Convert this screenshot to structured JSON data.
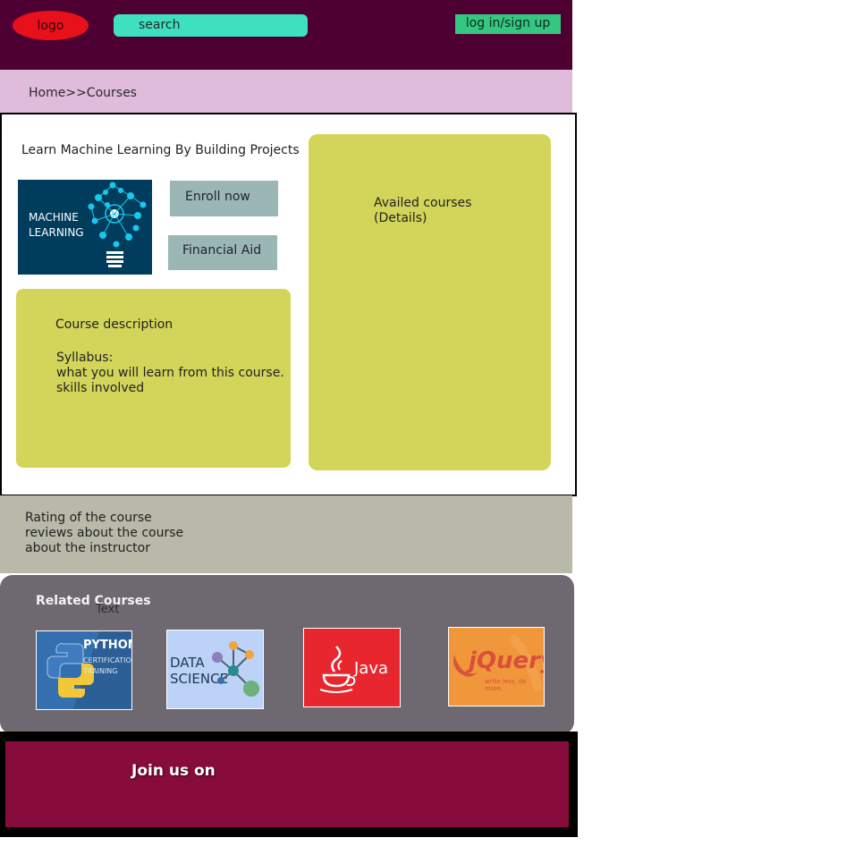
{
  "header": {
    "logo_label": "logo",
    "search_placeholder": "search",
    "login_label": "log in/sign up"
  },
  "breadcrumb": "Home>>Courses",
  "course": {
    "title": "Learn Machine Learning By Building Projects",
    "image_text_line1": "MACHINE",
    "image_text_line2": "LEARNING",
    "enroll_label": "Enroll now",
    "financial_aid_label": "Financial Aid",
    "description_title": "Course description",
    "syllabus_lines": [
      "Syllabus:",
      "what you will learn from this course.",
      "skills involved"
    ],
    "availed_lines": [
      "Availed courses",
      "(Details)"
    ]
  },
  "rating": {
    "lines": [
      "Rating of the course",
      "reviews about the course",
      "about the instructor"
    ]
  },
  "related": {
    "title": "Related Courses",
    "placeholder_text": "Text",
    "courses": [
      {
        "line1": "PYTHON",
        "line2": "CERTIFICATION",
        "line3": "TRAINING",
        "icon": "python-logo"
      },
      {
        "line1": "DATA",
        "line2": "SCIENCE",
        "icon": "network-graph"
      },
      {
        "label": "Java",
        "icon": "java-cup"
      },
      {
        "label": "jQuery",
        "tagline": "write less, do more.",
        "icon": "jquery-logo"
      }
    ]
  },
  "footer": {
    "join_label": "Join us on"
  },
  "colors": {
    "header_bg": "#4e0033",
    "breadcrumb_bg": "#dfbcdb",
    "panel_green": "#d2d55a",
    "button_teal": "#9ab7b5",
    "rating_bg": "#b8b9a8",
    "related_bg": "#6e6871",
    "footer_bg": "#870c3c"
  }
}
